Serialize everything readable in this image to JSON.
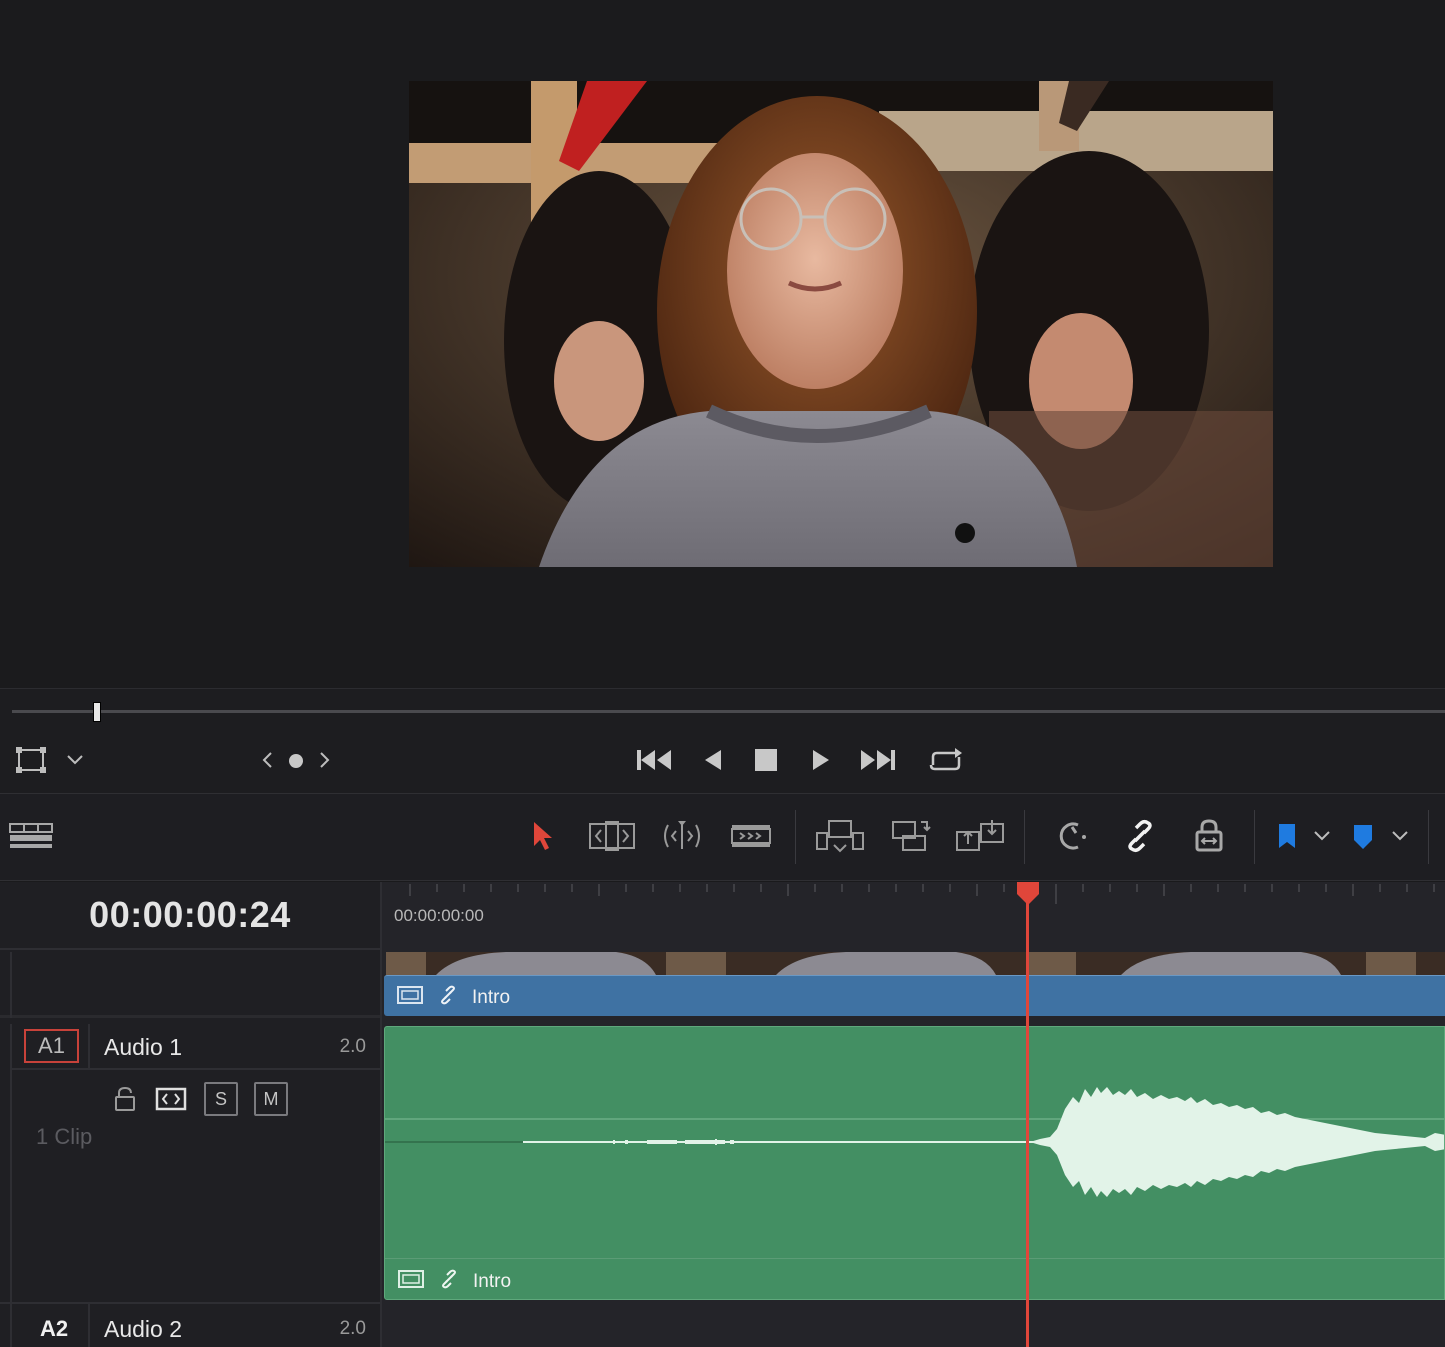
{
  "viewer": {
    "frame_description_icon": "video-frame"
  },
  "transport": {
    "buttons": [
      "jump-to-start",
      "play-reverse",
      "stop",
      "play",
      "jump-to-end",
      "loop"
    ]
  },
  "timeline": {
    "timecode": "00:00:00:24",
    "ruler_start": "00:00:00:00",
    "video_clip": {
      "name": "Intro"
    },
    "audio1": {
      "badge": "A1",
      "name": "Audio 1",
      "channels": "2.0",
      "solo": "S",
      "mute": "M",
      "clip_count": "1 Clip",
      "clip_name": "Intro"
    },
    "audio2": {
      "badge": "A2",
      "name": "Audio 2",
      "channels": "2.0"
    }
  },
  "colors": {
    "playhead": "#e0463a",
    "video_clip": "#3f72a3",
    "audio_clip": "#438f63",
    "flag": "#1f7be0",
    "selection_arrow": "#e0463a"
  }
}
